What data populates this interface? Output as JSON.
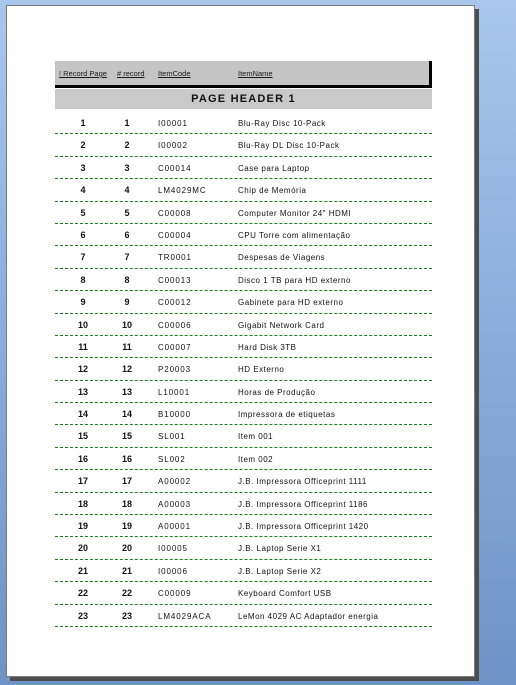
{
  "columns": {
    "record_page": "! Record Page",
    "record": "# record",
    "item_code": "ItemCode",
    "item_name": "ItemName"
  },
  "page_header": "PAGE HEADER 1",
  "rows": [
    {
      "page": "1",
      "record": "1",
      "code": "I00001",
      "name": "Blu-Ray Disc 10-Pack"
    },
    {
      "page": "2",
      "record": "2",
      "code": "I00002",
      "name": "Blu-Ray DL Disc 10-Pack"
    },
    {
      "page": "3",
      "record": "3",
      "code": "C00014",
      "name": "Case para Laptop"
    },
    {
      "page": "4",
      "record": "4",
      "code": "LM4029MC",
      "name": "Chip de Memória"
    },
    {
      "page": "5",
      "record": "5",
      "code": "C00008",
      "name": "Computer Monitor 24\" HDMI"
    },
    {
      "page": "6",
      "record": "6",
      "code": "C00004",
      "name": "CPU Torre com alimentação"
    },
    {
      "page": "7",
      "record": "7",
      "code": "TR0001",
      "name": "Despesas de Viagens"
    },
    {
      "page": "8",
      "record": "8",
      "code": "C00013",
      "name": "Disco 1 TB para HD externo"
    },
    {
      "page": "9",
      "record": "9",
      "code": "C00012",
      "name": "Gabinete para HD externo"
    },
    {
      "page": "10",
      "record": "10",
      "code": "C00006",
      "name": "Gigabit Network Card"
    },
    {
      "page": "11",
      "record": "11",
      "code": "C00007",
      "name": "Hard Disk 3TB"
    },
    {
      "page": "12",
      "record": "12",
      "code": "P20003",
      "name": "HD Externo"
    },
    {
      "page": "13",
      "record": "13",
      "code": "L10001",
      "name": "Horas de Produção"
    },
    {
      "page": "14",
      "record": "14",
      "code": "B10000",
      "name": "Impressora de etiquetas"
    },
    {
      "page": "15",
      "record": "15",
      "code": "SL001",
      "name": "Item 001"
    },
    {
      "page": "16",
      "record": "16",
      "code": "SL002",
      "name": "Item 002"
    },
    {
      "page": "17",
      "record": "17",
      "code": "A00002",
      "name": "J.B. Impressora Officeprint 1111"
    },
    {
      "page": "18",
      "record": "18",
      "code": "A00003",
      "name": "J.B. Impressora Officeprint 1186"
    },
    {
      "page": "19",
      "record": "19",
      "code": "A00001",
      "name": "J.B. Impressora Officeprint 1420"
    },
    {
      "page": "20",
      "record": "20",
      "code": "I00005",
      "name": "J.B. Laptop Serie X1"
    },
    {
      "page": "21",
      "record": "21",
      "code": "I00006",
      "name": "J.B. Laptop Serie X2"
    },
    {
      "page": "22",
      "record": "22",
      "code": "C00009",
      "name": "Keyboard Comfort USB"
    },
    {
      "page": "23",
      "record": "23",
      "code": "LM4029ACA",
      "name": "LeMon 4029 AC Adaptador energia"
    }
  ]
}
